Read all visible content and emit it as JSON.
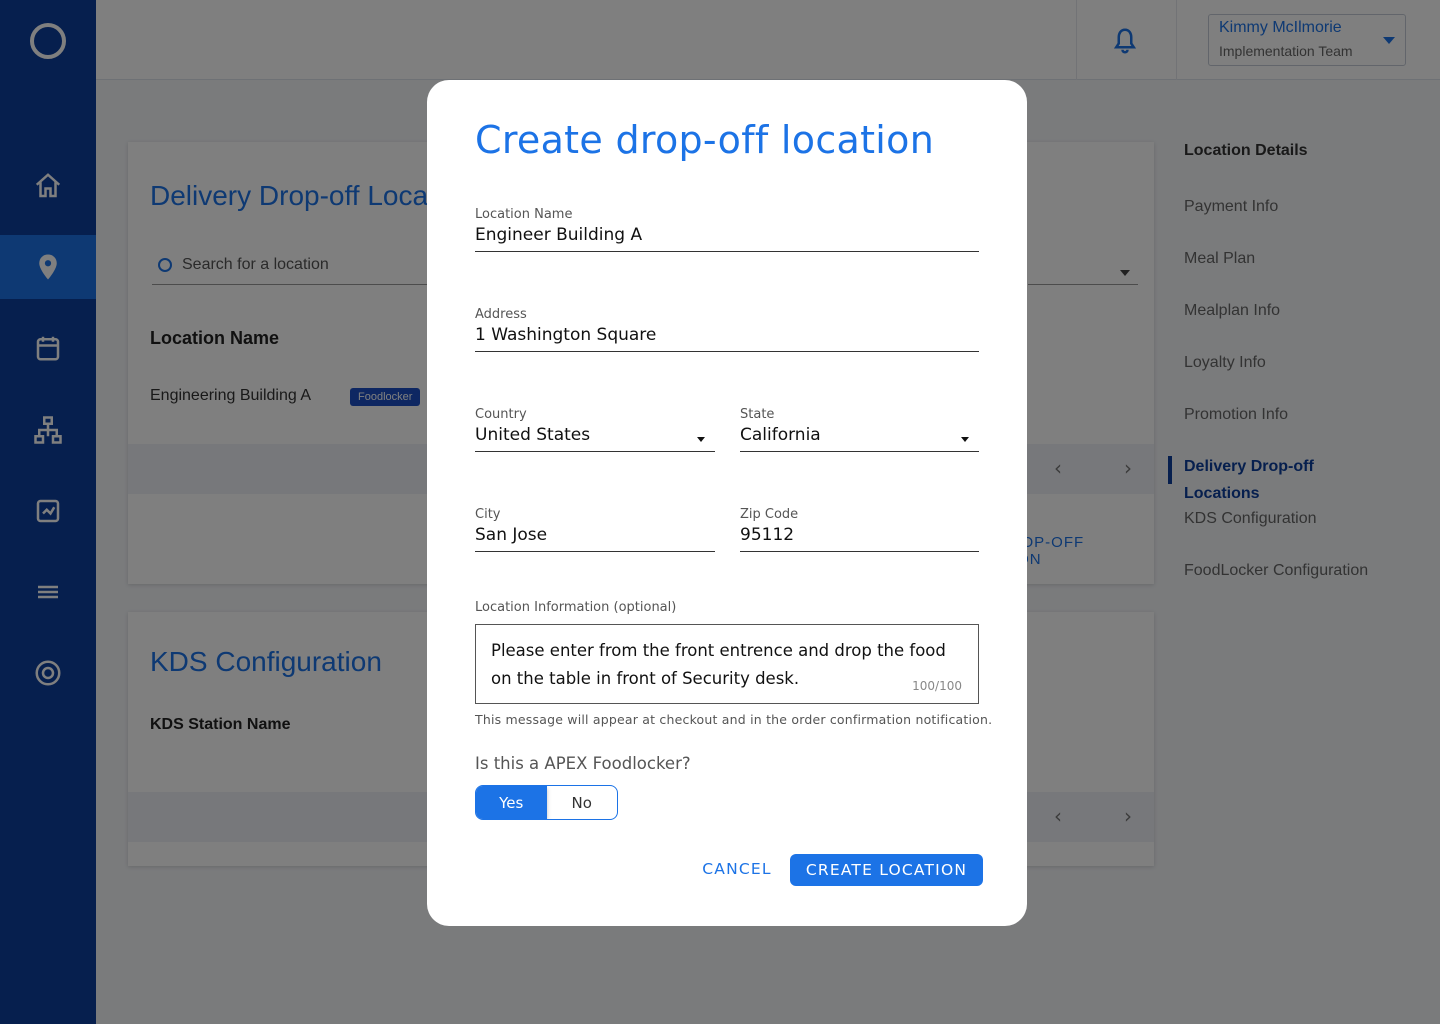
{
  "app": {
    "user_name": "Kimmy McIlmorie",
    "user_team": "Implementation Team"
  },
  "background": {
    "card1": {
      "title": "Delivery Drop-off Locations",
      "search_placeholder": "Search for a location",
      "column_header": "Location Name",
      "row_name": "Engineering Building A",
      "row_badge": "Foodlocker",
      "add_link": "ADD DROP-OFF LOCATION"
    },
    "card2": {
      "title": "KDS Configuration",
      "column_header": "KDS Station Name"
    },
    "right_nav": {
      "title": "Location Details",
      "items": [
        "Payment Info",
        "Meal Plan",
        "Mealplan Info",
        "Loyalty Info",
        "Promotion Info",
        "Delivery Drop-off",
        "Locations",
        "KDS Configuration",
        "FoodLocker Configuration"
      ]
    }
  },
  "modal": {
    "title": "Create drop-off location",
    "fields": {
      "location_name": {
        "label": "Location Name",
        "value": "Engineer Building A"
      },
      "address": {
        "label": "Address",
        "value": "1 Washington Square"
      },
      "country": {
        "label": "Country",
        "value": "United States"
      },
      "state": {
        "label": "State",
        "value": "California"
      },
      "city": {
        "label": "City",
        "value": "San Jose"
      },
      "zip": {
        "label": "Zip Code",
        "value": "95112"
      }
    },
    "location_info": {
      "label": "Location Information (optional)",
      "value": "Please enter from the front entrence and drop the food on the table in front of Security desk.",
      "counter": "100/100",
      "hint": "This message will appear at checkout and in the order confirmation notification."
    },
    "foodlocker": {
      "question": "Is this a APEX Foodlocker?",
      "yes": "Yes",
      "no": "No",
      "selected": "Yes"
    },
    "buttons": {
      "cancel": "CANCEL",
      "create": "CREATE LOCATION"
    }
  },
  "colors": {
    "sidebar": "#0d3e9c",
    "accent": "#1c73e6"
  }
}
